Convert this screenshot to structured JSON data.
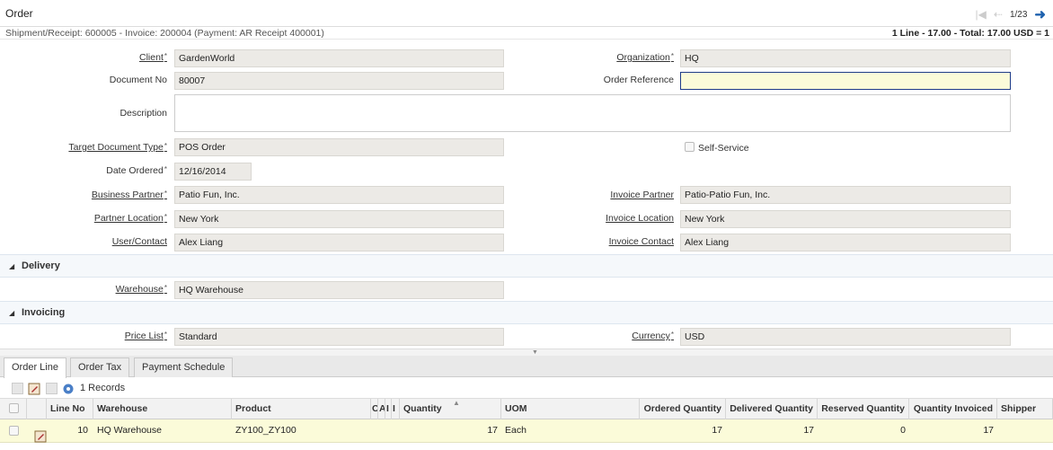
{
  "window": {
    "title": "Order",
    "page": "1/23"
  },
  "info": {
    "text": "Shipment/Receipt: 600005 - Invoice: 200004 (Payment: AR Receipt 400001)",
    "summary": "1 Line - 17.00 - Total: 17.00 USD = 1"
  },
  "form": {
    "client": {
      "label": "Client",
      "value": "GardenWorld"
    },
    "organization": {
      "label": "Organization",
      "value": "HQ"
    },
    "document_no": {
      "label": "Document No",
      "value": "80007"
    },
    "order_reference": {
      "label": "Order Reference",
      "value": ""
    },
    "description": {
      "label": "Description",
      "value": ""
    },
    "target_doc_type": {
      "label": "Target Document Type",
      "value": "POS Order"
    },
    "self_service": {
      "label": "Self-Service",
      "checked": false
    },
    "date_ordered": {
      "label": "Date Ordered",
      "value": "12/16/2014"
    },
    "business_partner": {
      "label": "Business Partner",
      "value": "Patio Fun, Inc."
    },
    "invoice_partner": {
      "label": "Invoice Partner",
      "value": "Patio-Patio Fun, Inc."
    },
    "partner_location": {
      "label": "Partner Location",
      "value": "New York"
    },
    "invoice_location": {
      "label": "Invoice Location",
      "value": "New York"
    },
    "user_contact": {
      "label": "User/Contact",
      "value": "Alex Liang"
    },
    "invoice_contact": {
      "label": "Invoice Contact",
      "value": "Alex Liang"
    }
  },
  "delivery": {
    "title": "Delivery",
    "warehouse": {
      "label": "Warehouse",
      "value": "HQ Warehouse"
    }
  },
  "invoicing": {
    "title": "Invoicing",
    "price_list": {
      "label": "Price List",
      "value": "Standard"
    },
    "currency": {
      "label": "Currency",
      "value": "USD"
    }
  },
  "tabs": [
    {
      "label": "Order Line"
    },
    {
      "label": "Order Tax"
    },
    {
      "label": "Payment Schedule"
    }
  ],
  "grid": {
    "records": "1 Records",
    "columns": [
      "Line No",
      "Warehouse",
      "Product",
      "C",
      "A",
      "I",
      "I",
      "Quantity",
      "UOM",
      "Ordered Quantity",
      "Delivered Quantity",
      "Reserved Quantity",
      "Quantity Invoiced",
      "Shipper"
    ],
    "rows": [
      {
        "line_no": "10",
        "warehouse": "HQ Warehouse",
        "product": "ZY100_ZY100",
        "quantity": "17",
        "uom": "Each",
        "ordered": "17",
        "delivered": "17",
        "reserved": "0",
        "invoiced": "17",
        "shipper": ""
      }
    ]
  },
  "colors": {
    "accent": "#1f62ae",
    "edit_bg": "#fbfbd9",
    "field_bg": "#eceae6"
  },
  "icons": {
    "first": "first-page-icon",
    "prev": "previous-icon",
    "next": "next-icon",
    "edit": "edit-record-icon",
    "settings": "gear-icon",
    "sort": "sort-ascending-icon"
  }
}
